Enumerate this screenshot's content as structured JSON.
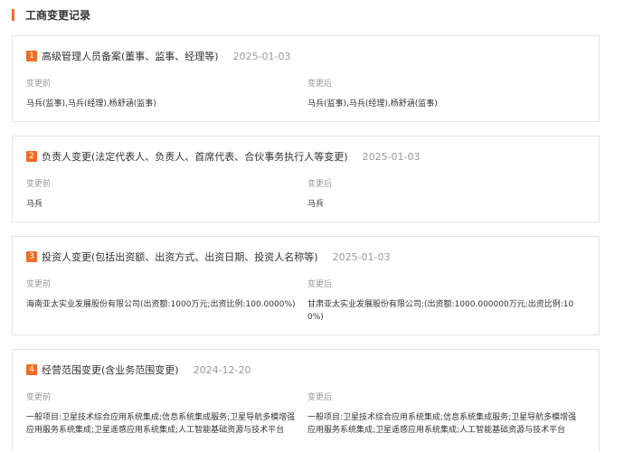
{
  "section": {
    "title": "工商变更记录"
  },
  "labels": {
    "before": "变更前",
    "after": "变更后"
  },
  "records": [
    {
      "index": "1",
      "title": "高级管理人员备案(董事、监事、经理等)",
      "date": "2025-01-03",
      "before": "马兵(监事),马兵(经理),杨舒涵(监事)",
      "after": "马兵(监事),马兵(经理),杨舒涵(监事)"
    },
    {
      "index": "2",
      "title": "负责人变更(法定代表人、负责人、首席代表、合伙事务执行人等变更)",
      "date": "2025-01-03",
      "before": "马兵",
      "after": "马兵"
    },
    {
      "index": "3",
      "title": "投资人变更(包括出资额、出资方式、出资日期、投资人名称等)",
      "date": "2025-01-03",
      "before": "海南亚太实业发展股份有限公司(出资额:1000万元;出资比例:100.0000%)",
      "after": "甘肃亚太实业发展股份有限公司:(出资额:1000.000000万元;出资比例:100%)"
    },
    {
      "index": "4",
      "title": "经营范围变更(含业务范围变更)",
      "date": "2024-12-20",
      "before": "一般项目:卫星技术综合应用系统集成;信息系统集成服务;卫星导航多模增强应用服务系统集成;卫星遥感应用系统集成;人工智能基础资源与技术平台",
      "after": "一般项目:卫星技术综合应用系统集成;信息系统集成服务;卫星导航多模增强应用服务系统集成;卫星遥感应用系统集成;人工智能基础资源与技术平台"
    }
  ]
}
